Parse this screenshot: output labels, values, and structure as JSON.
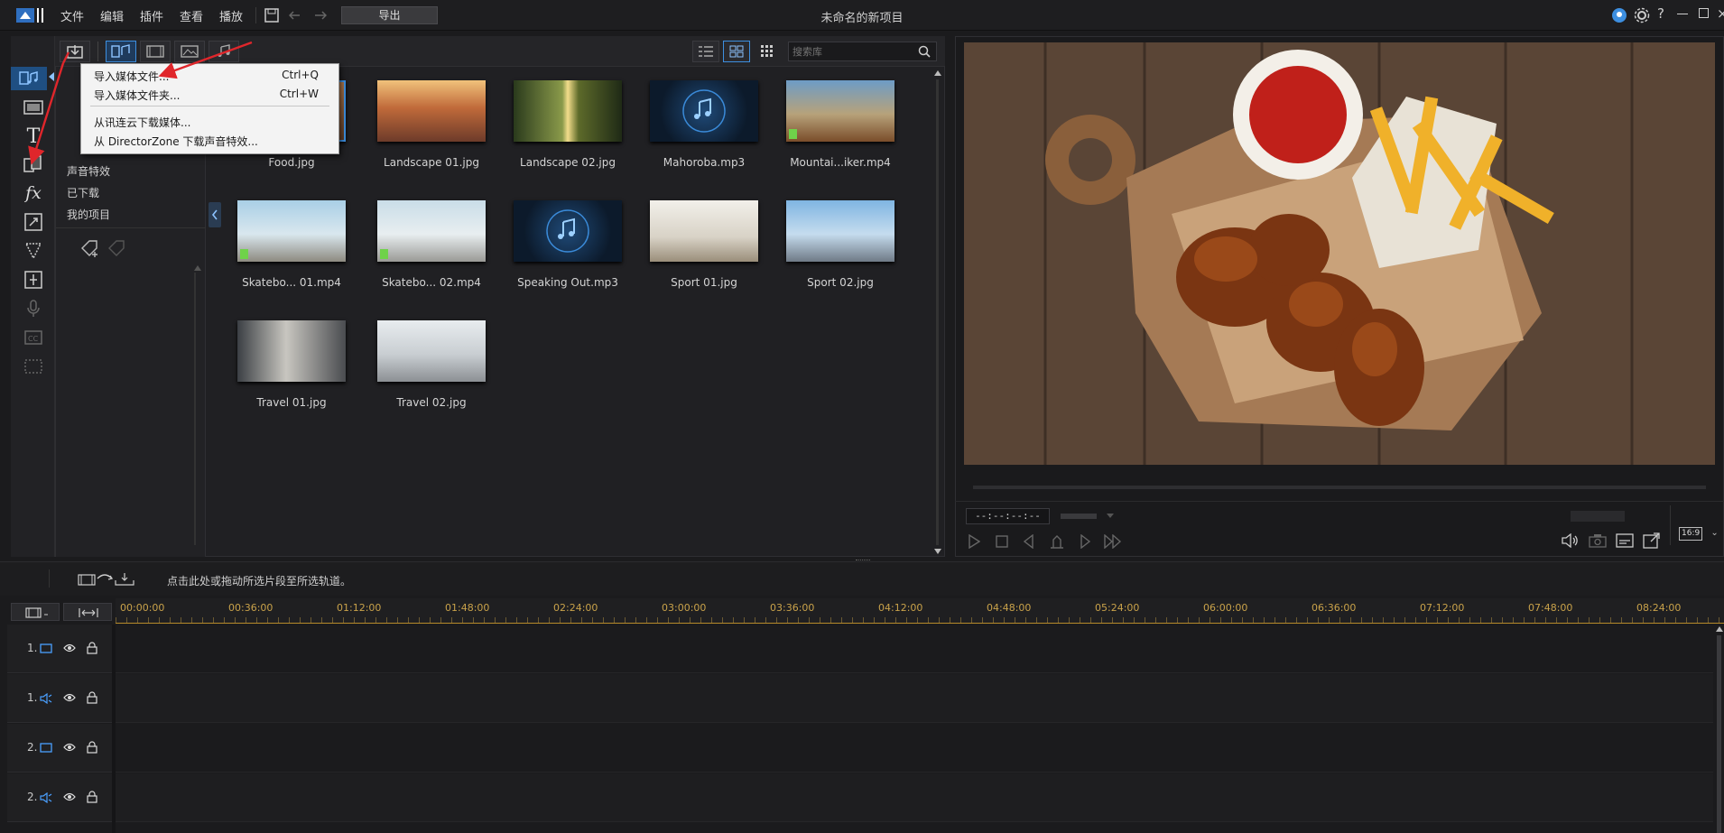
{
  "app": {
    "title": "未命名的新项目",
    "menu": [
      "文件",
      "编辑",
      "插件",
      "查看",
      "播放"
    ],
    "export_label": "导出"
  },
  "library": {
    "search_placeholder": "搜索库",
    "categories": [
      "声音特效",
      "已下载",
      "我的项目"
    ],
    "items": [
      {
        "name": "Food.jpg",
        "type": "image"
      },
      {
        "name": "Landscape 01.jpg",
        "type": "image"
      },
      {
        "name": "Landscape 02.jpg",
        "type": "image"
      },
      {
        "name": "Mahoroba.mp3",
        "type": "audio"
      },
      {
        "name": "Mountai...iker.mp4",
        "type": "video"
      },
      {
        "name": "Skatebo... 01.mp4",
        "type": "video"
      },
      {
        "name": "Skatebo... 02.mp4",
        "type": "video"
      },
      {
        "name": "Speaking Out.mp3",
        "type": "audio"
      },
      {
        "name": "Sport 01.jpg",
        "type": "image"
      },
      {
        "name": "Sport 02.jpg",
        "type": "image"
      },
      {
        "name": "Travel 01.jpg",
        "type": "image"
      },
      {
        "name": "Travel 02.jpg",
        "type": "image"
      }
    ]
  },
  "import_menu": {
    "items": [
      {
        "label": "导入媒体文件...",
        "shortcut": "Ctrl+Q"
      },
      {
        "label": "导入媒体文件夹...",
        "shortcut": "Ctrl+W"
      },
      {
        "label": "从讯连云下载媒体...",
        "shortcut": ""
      },
      {
        "label": "从 DirectorZone 下载声音特效...",
        "shortcut": ""
      }
    ]
  },
  "preview": {
    "timecode": "--:--:--:--",
    "aspect": "16:9"
  },
  "timeline": {
    "hint": "点击此处或拖动所选片段至所选轨道。",
    "ruler": [
      "00:00:00",
      "00:36:00",
      "01:12:00",
      "01:48:00",
      "02:24:00",
      "03:00:00",
      "03:36:00",
      "04:12:00",
      "04:48:00",
      "05:24:00",
      "06:00:00",
      "06:36:00",
      "07:12:00",
      "07:48:00",
      "08:24:00"
    ],
    "tracks": [
      {
        "label": "1.",
        "kind": "video"
      },
      {
        "label": "1.",
        "kind": "audio"
      },
      {
        "label": "2.",
        "kind": "video"
      },
      {
        "label": "2.",
        "kind": "audio"
      }
    ]
  },
  "colors": {
    "accent": "#3d8fe0",
    "ruler": "#c9a24a",
    "arrow": "#e0262b"
  }
}
